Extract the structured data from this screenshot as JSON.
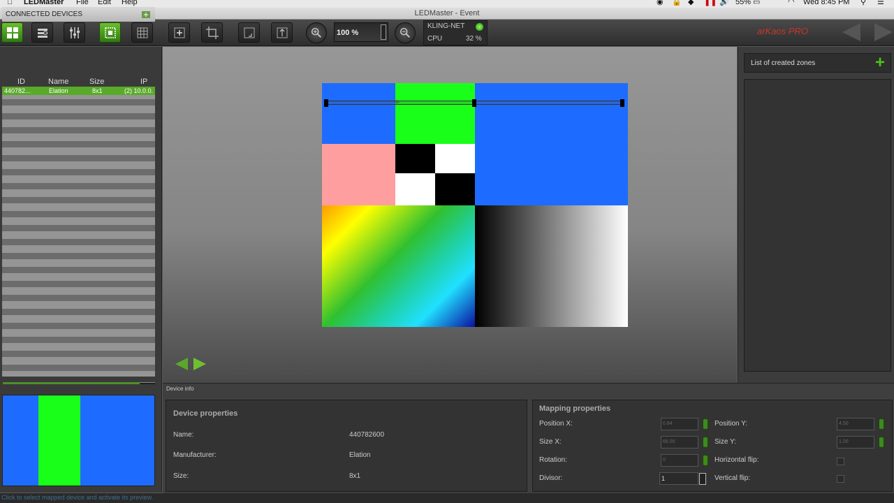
{
  "menubar": {
    "app": "LEDMaster",
    "items": [
      "File",
      "Edit",
      "Help"
    ],
    "battery": "55%",
    "clock": "Wed 8:45 PM"
  },
  "window": {
    "title": "LEDMaster - Event"
  },
  "toolbar": {
    "zoom_value": "100 %",
    "network_label": "KLING-NET",
    "cpu_label": "CPU",
    "cpu_value": "32 %",
    "brand": "arKaos PRO"
  },
  "connected_devices": {
    "title": "CONNECTED DEVICES",
    "columns": [
      "ID",
      "Name",
      "Size",
      "IP"
    ],
    "rows": [
      {
        "id": "440782...",
        "name": "Elation",
        "size": "8x1",
        "ip": "(2) 10.0.0."
      }
    ]
  },
  "canvas": {
    "colors": {
      "blue": "#1e6cff",
      "green": "#1aff1a",
      "pink": "#ff9e9e",
      "black": "#000000",
      "white": "#ffffff"
    }
  },
  "zones": {
    "title": "List of created zones"
  },
  "device_info": {
    "tab_label": "Device info",
    "properties_title": "Device properties",
    "fields": [
      {
        "label": "Name:",
        "value": "440782600"
      },
      {
        "label": "Manufacturer:",
        "value": "Elation"
      },
      {
        "label": "Size:",
        "value": "8x1"
      }
    ]
  },
  "mapping": {
    "title": "Mapping properties",
    "position_x_label": "Position X:",
    "position_x": "0.84",
    "size_x_label": "Size X:",
    "size_x": "66.00",
    "rotation_label": "Rotation:",
    "rotation": "0",
    "divisor_label": "Divisor:",
    "divisor": "1",
    "position_y_label": "Position Y:",
    "position_y": "4.50",
    "size_y_label": "Size Y:",
    "size_y": "1.00",
    "hflip_label": "Horizontal flip:",
    "vflip_label": "Vertical flip:"
  },
  "status": {
    "text": "Click to select mapped device and activate its preview."
  }
}
